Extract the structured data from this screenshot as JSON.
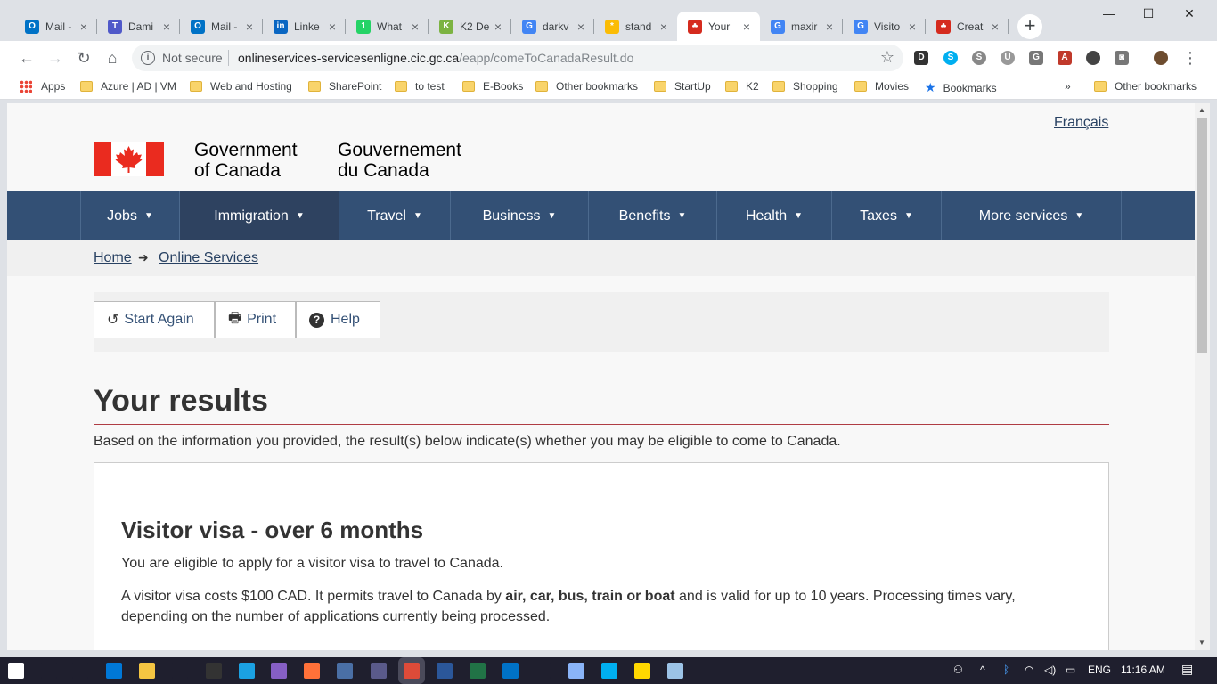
{
  "browser": {
    "tabs": [
      {
        "label": "Mail -",
        "icon": "outlook-icon",
        "color": "#0072c6",
        "glyph": "O"
      },
      {
        "label": "Dami",
        "icon": "teams-icon",
        "color": "#5059c9",
        "glyph": "T"
      },
      {
        "label": "Mail -",
        "icon": "outlook-icon",
        "color": "#0072c6",
        "glyph": "O"
      },
      {
        "label": "Linke",
        "icon": "linkedin-icon",
        "color": "#0a66c2",
        "glyph": "in"
      },
      {
        "label": "What",
        "icon": "whatsapp-icon",
        "color": "#25d366",
        "glyph": "1"
      },
      {
        "label": "K2 De",
        "icon": "k2-icon",
        "color": "#7cb342",
        "glyph": "K"
      },
      {
        "label": "darkv",
        "icon": "google-icon",
        "color": "#4285f4",
        "glyph": "G"
      },
      {
        "label": "stand",
        "icon": "colorful-icon",
        "color": "#fbbc05",
        "glyph": "*"
      },
      {
        "label": "Your",
        "icon": "canada-flag-icon",
        "color": "#d52b1e",
        "glyph": "♣"
      },
      {
        "label": "maxir",
        "icon": "google-icon",
        "color": "#4285f4",
        "glyph": "G"
      },
      {
        "label": "Visito",
        "icon": "google-icon",
        "color": "#4285f4",
        "glyph": "G"
      },
      {
        "label": "Creat",
        "icon": "canada-flag-icon",
        "color": "#d52b1e",
        "glyph": "♣"
      }
    ],
    "active_tab_index": 8,
    "new_tab": "+",
    "window_controls": {
      "minimize": "—",
      "maximize": "☐",
      "close": "✕"
    },
    "address": {
      "security_label": "Not secure",
      "url_host": "onlineservices-servicesenligne.cic.gc.ca",
      "url_path": "/eapp/comeToCanadaResult.do"
    },
    "bookmarks": [
      {
        "label": "Apps",
        "type": "apps"
      },
      {
        "label": "Azure | AD | VM",
        "type": "folder"
      },
      {
        "label": "Web and Hosting",
        "type": "folder"
      },
      {
        "label": "SharePoint",
        "type": "folder"
      },
      {
        "label": "to test",
        "type": "folder"
      },
      {
        "label": "E-Books",
        "type": "folder"
      },
      {
        "label": "Other bookmarks",
        "type": "folder"
      },
      {
        "label": "StartUp",
        "type": "folder"
      },
      {
        "label": "K2",
        "type": "folder"
      },
      {
        "label": "Shopping",
        "type": "folder"
      },
      {
        "label": "Movies",
        "type": "folder"
      },
      {
        "label": "Bookmarks",
        "type": "star"
      },
      {
        "label": "»",
        "type": "overflow"
      },
      {
        "label": "Other bookmarks",
        "type": "folder"
      }
    ]
  },
  "page": {
    "language_toggle": "Français",
    "gov_en_line1": "Government",
    "gov_en_line2": "of Canada",
    "gov_fr_line1": "Gouvernement",
    "gov_fr_line2": "du Canada",
    "menu": [
      "Jobs",
      "Immigration",
      "Travel",
      "Business",
      "Benefits",
      "Health",
      "Taxes",
      "More services"
    ],
    "active_menu": "Immigration",
    "breadcrumb": [
      "Home",
      "Online Services"
    ],
    "buttons": {
      "start_again": "Start Again",
      "print": "Print",
      "help": "Help"
    },
    "title": "Your results",
    "intro": "Based on the information you provided, the result(s) below indicate(s) whether you may be eligible to come to Canada.",
    "result": {
      "heading": "Visitor visa - over 6 months",
      "eligible": "You are eligible to apply for a visitor visa to travel to Canada.",
      "cost_pre": "A visitor visa costs $100 CAD. It permits travel to Canada by ",
      "cost_bold": "air, car, bus, train or boat",
      "cost_post": " and is valid for up to 10 years. Processing times vary, depending on the number of applications currently being processed."
    },
    "colors": {
      "menu_bg": "#335075",
      "menu_active": "#2e4260",
      "link": "#284162",
      "rule": "#af3c43",
      "flag_red": "#ea2b1f"
    }
  },
  "taskbar": {
    "apps": [
      "start-icon",
      "search-icon",
      "task-view-icon",
      "edge-icon",
      "file-explorer-icon",
      "store-icon",
      "cmd-icon",
      "ie-icon",
      "visual-studio-icon",
      "firefox-icon",
      "remote-icon",
      "app-icon",
      "chrome-icon",
      "word-icon",
      "excel-icon",
      "outlook-icon",
      "settings-icon",
      "app2-icon",
      "skype-icon",
      "sticky-notes-icon",
      "notepad-icon"
    ],
    "language": "ENG",
    "time": "11:16 AM"
  }
}
